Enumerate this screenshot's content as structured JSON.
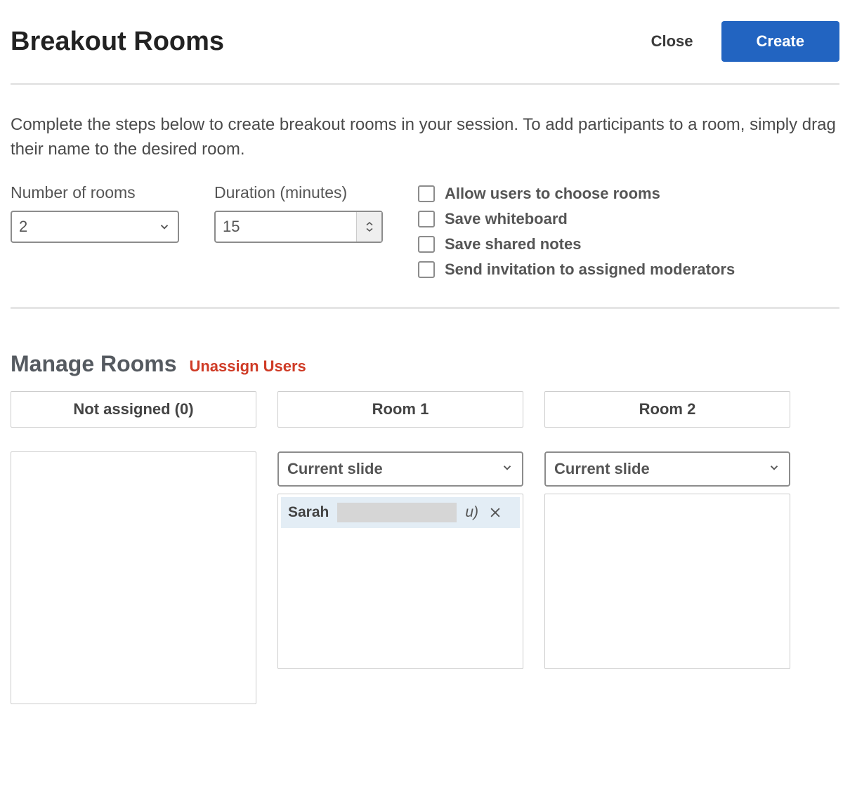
{
  "header": {
    "title": "Breakout Rooms",
    "close_label": "Close",
    "create_label": "Create"
  },
  "instructions": "Complete the steps below to create breakout rooms in your session. To add participants to a room, simply drag their name to the desired room.",
  "config": {
    "rooms_label": "Number of rooms",
    "rooms_value": "2",
    "duration_label": "Duration (minutes)",
    "duration_value": "15",
    "options": [
      {
        "label": "Allow users to choose rooms",
        "checked": false
      },
      {
        "label": "Save whiteboard",
        "checked": false
      },
      {
        "label": "Save shared notes",
        "checked": false
      },
      {
        "label": "Send invitation to assigned moderators",
        "checked": false
      }
    ]
  },
  "manage": {
    "title": "Manage Rooms",
    "unassign_label": "Unassign Users"
  },
  "columns": {
    "unassigned": {
      "header": "Not assigned (0)"
    },
    "room1": {
      "header": "Room 1",
      "slide_selected": "Current slide",
      "users": [
        {
          "name": "Sarah",
          "suffix": "u)"
        }
      ]
    },
    "room2": {
      "header": "Room 2",
      "slide_selected": "Current slide",
      "users": []
    }
  },
  "colors": {
    "primary": "#2264c1",
    "danger": "#cf3b26"
  }
}
